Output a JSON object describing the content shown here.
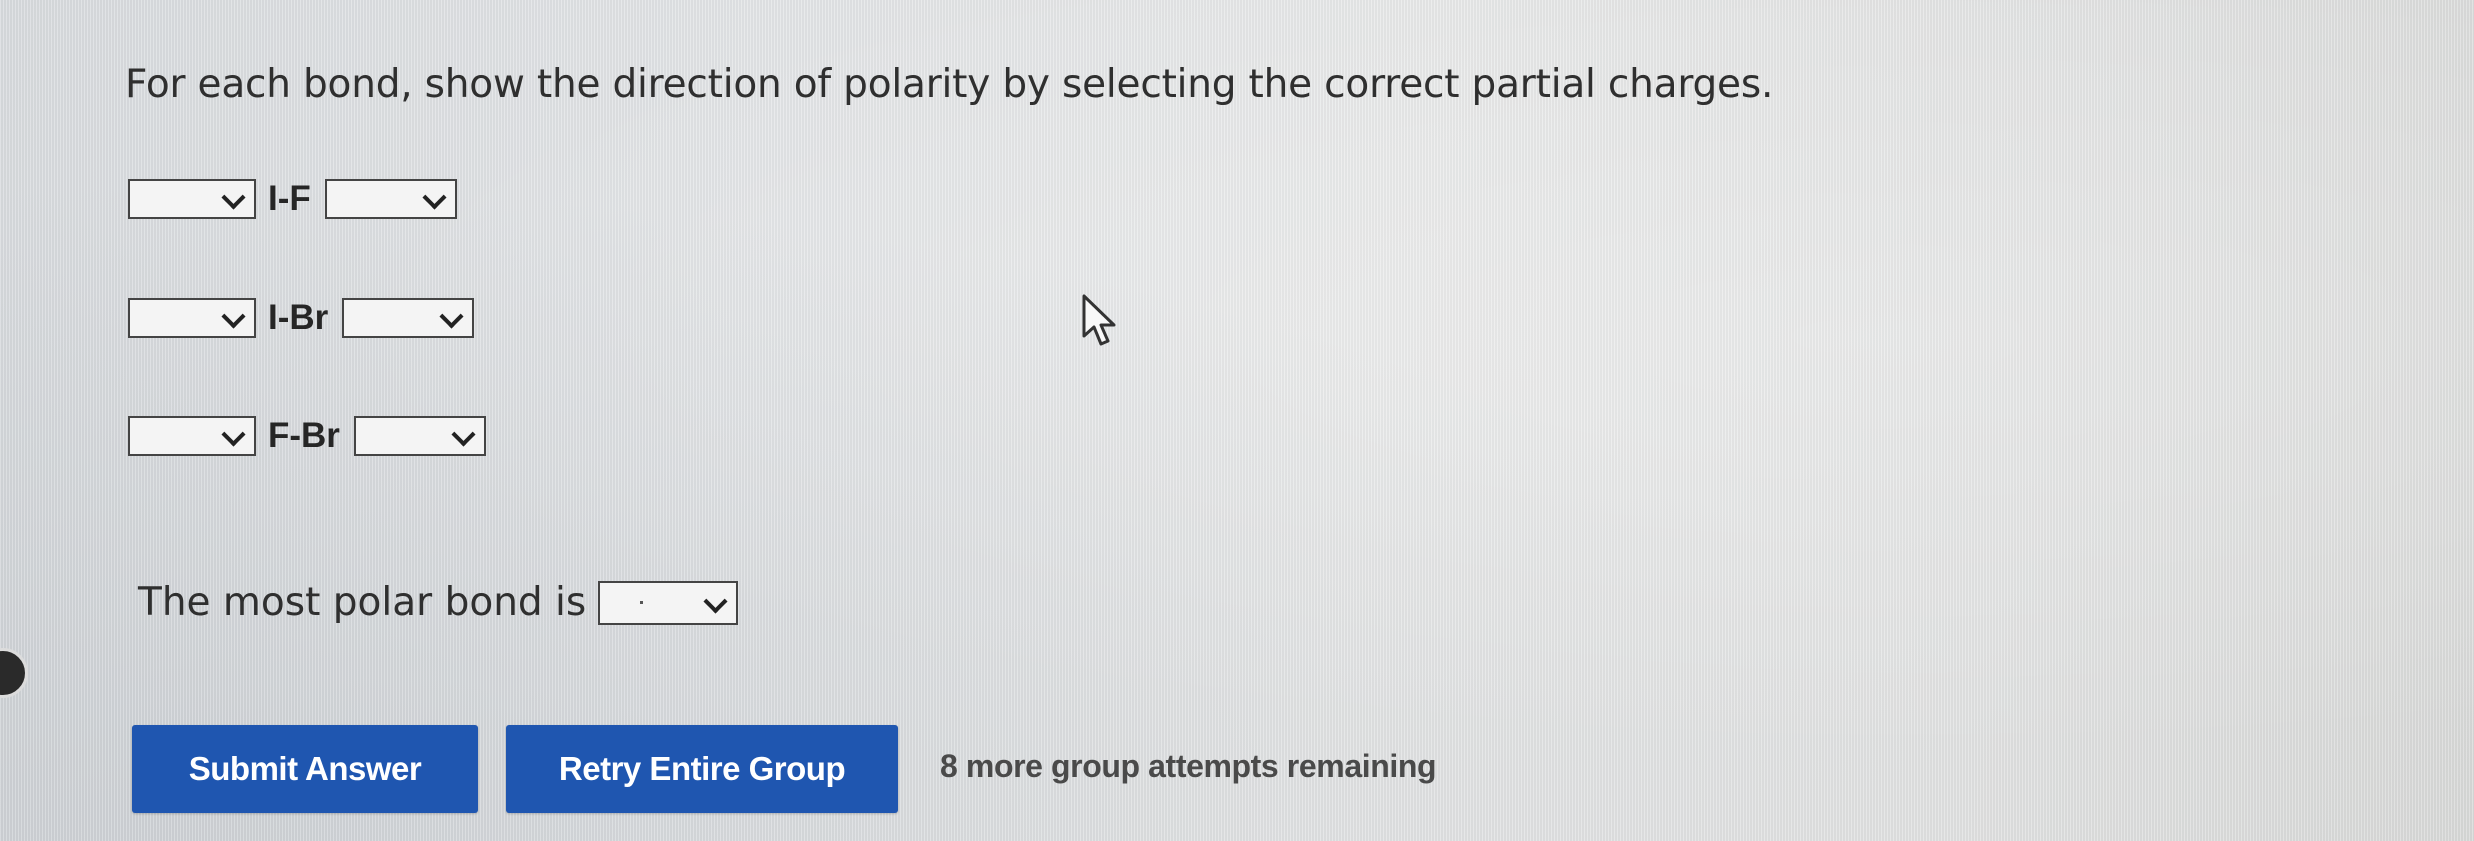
{
  "question": {
    "text": "For each bond, show the direction of polarity by selecting the correct partial charges."
  },
  "bonds": [
    {
      "label": "I-F",
      "left_value": "",
      "right_value": ""
    },
    {
      "label": "I-Br",
      "left_value": "",
      "right_value": ""
    },
    {
      "label": "F-Br",
      "left_value": "",
      "right_value": ""
    }
  ],
  "most_polar": {
    "label": "The most polar bond is",
    "value": ""
  },
  "buttons": {
    "submit": "Submit Answer",
    "retry": "Retry Entire Group"
  },
  "attempts_text": "8 more group attempts remaining",
  "icons": {
    "dropdown": "chevron-down-icon",
    "cursor": "mouse-pointer-icon"
  },
  "colors": {
    "button": "#1f56b0",
    "button_text": "#ffffff",
    "text": "#2f2f2f"
  }
}
